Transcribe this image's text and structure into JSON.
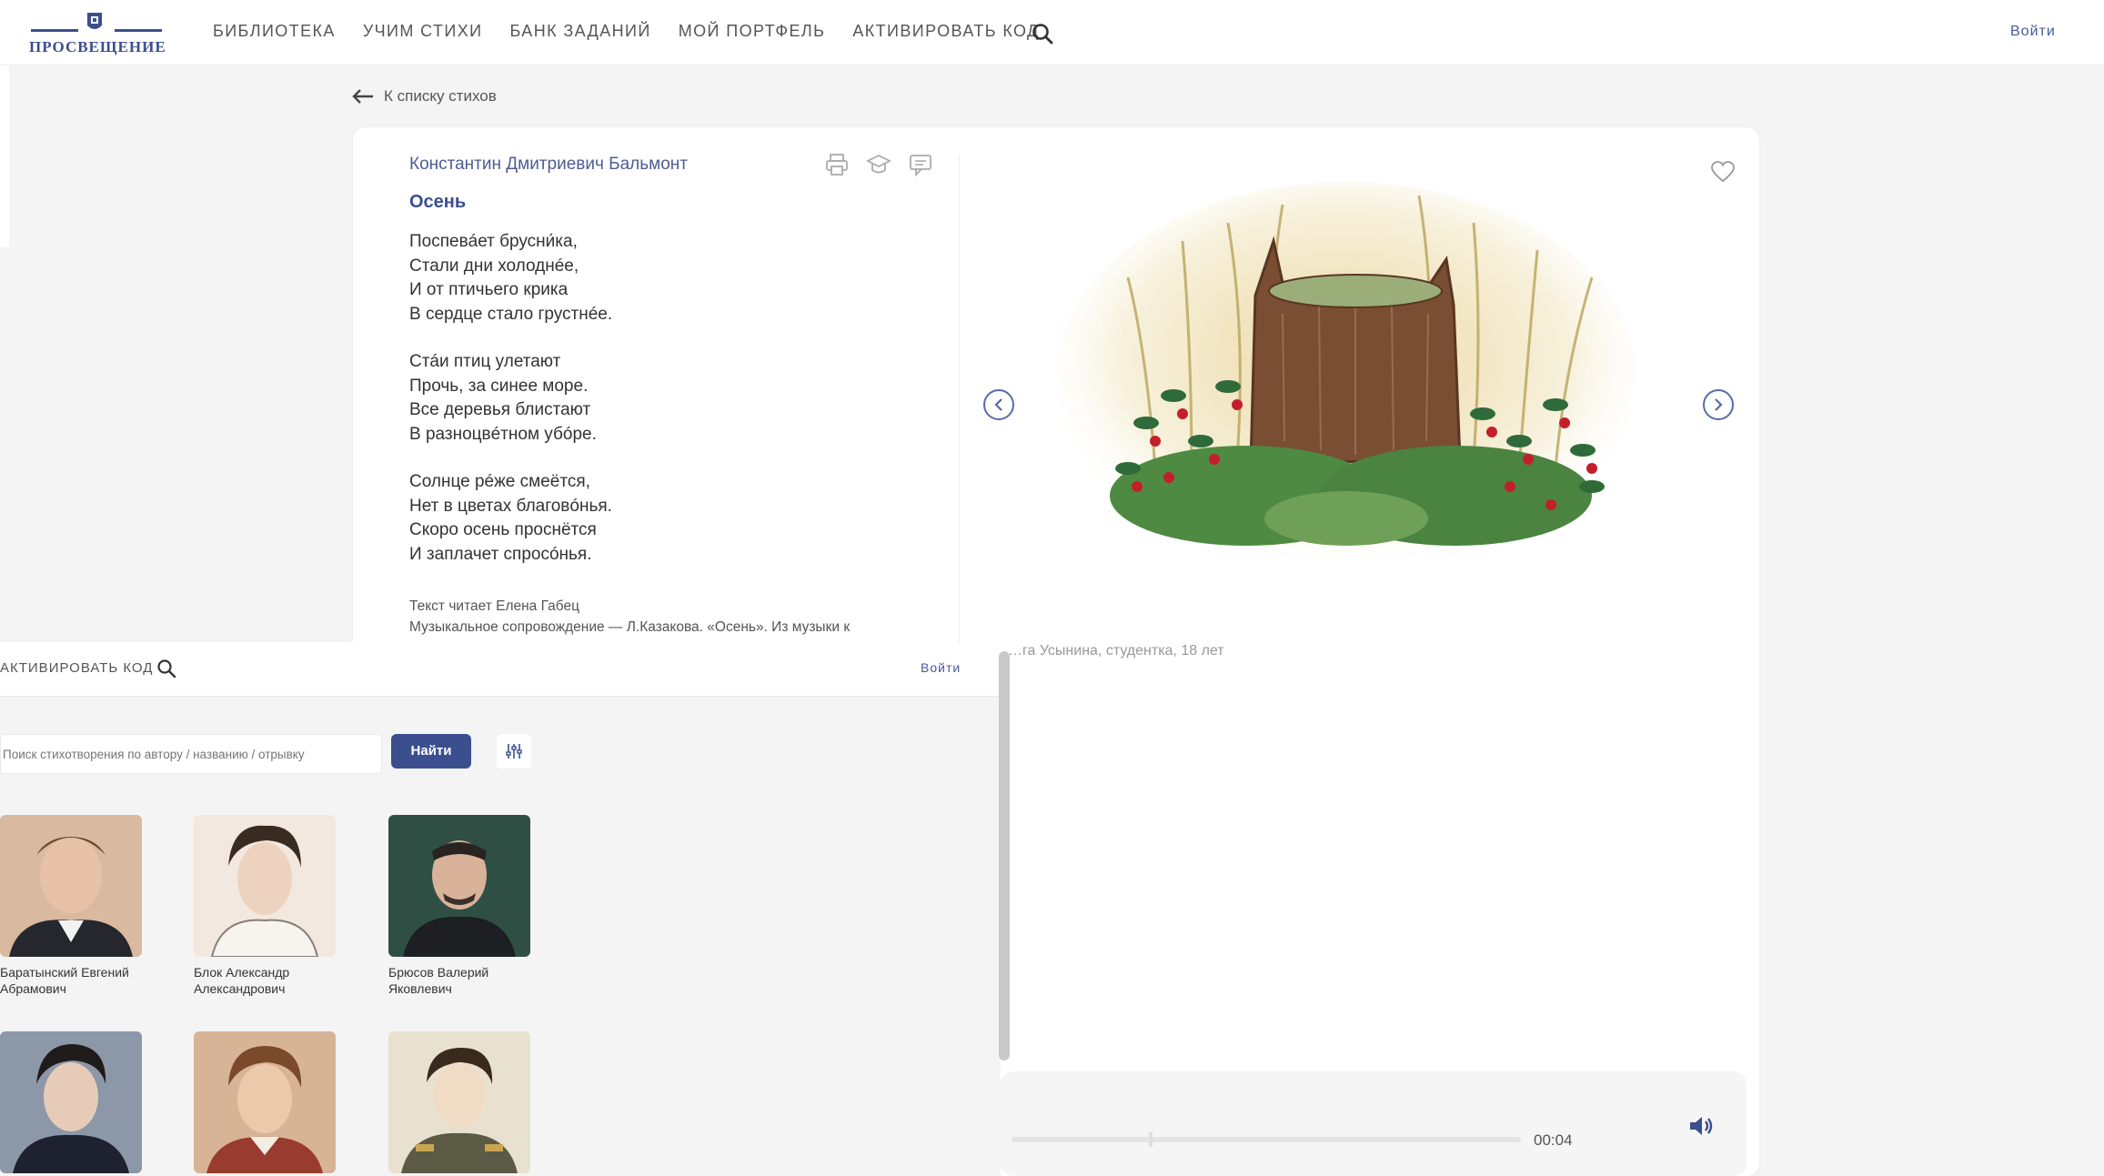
{
  "header": {
    "logo_text": "ПРОСВЕЩЕНИЕ",
    "nav": [
      "БИБЛИОТЕКА",
      "УЧИМ СТИХИ",
      "БАНК ЗАДАНИЙ",
      "МОЙ ПОРТФЕЛЬ",
      "АКТИВИРОВАТЬ КОД"
    ],
    "search_icon": "search-icon",
    "login": "Войти"
  },
  "back_link": "К списку стихов",
  "poem": {
    "author": "Константин Дмитриевич Бальмонт",
    "title": "Осень",
    "stanzas": [
      [
        "Поспевáет брусни́ка,",
        "Стали дни холоднée,",
        "И от птичьего крика",
        "В сердце стало грустнée."
      ],
      [
        "Стáи птиц улетают",
        "Прочь, за синее море.",
        "Все деревья блистают",
        "В разноцвéтном убóре."
      ],
      [
        "Солнце рéже смеётся,",
        "Нет в цветах благовóнья.",
        "Скоро осень проснётся",
        "И заплачет спросóнья."
      ]
    ],
    "credit_reader": "Текст читает Елена Габец",
    "credit_music": "Музыкальное сопровождение — Л.Казакова. «Осень». Из музыки к",
    "tool_icons": [
      "print-icon",
      "graduation-cap-icon",
      "comment-icon"
    ]
  },
  "illustration": {
    "caption": "…га Усынина, студентка, 18 лет",
    "icons": [
      "heart-icon",
      "chevron-left-icon",
      "chevron-right-icon"
    ]
  },
  "player": {
    "time": "00:04",
    "progress": 0.27,
    "icon": "volume-icon"
  },
  "overlay": {
    "nav_item": "АКТИВИРОВАТЬ КОД",
    "login": "Войти",
    "search_placeholder": "Поиск стихотворения по автору / названию / отрывку",
    "search_button": "Найти",
    "filter_icon": "filter-sliders-icon",
    "poets": [
      {
        "line1": "Баратынский Евгений",
        "line2": "Абрамович"
      },
      {
        "line1": "Блок Александр",
        "line2": "Александрович"
      },
      {
        "line1": "Брюсов Валерий",
        "line2": "Яковлевич"
      },
      {
        "line1": "",
        "line2": ""
      },
      {
        "line1": "",
        "line2": ""
      },
      {
        "line1": "",
        "line2": ""
      }
    ]
  },
  "colors": {
    "brand": "#3b4f8f",
    "link": "#4a5a9a",
    "background": "#f4f4f4"
  }
}
